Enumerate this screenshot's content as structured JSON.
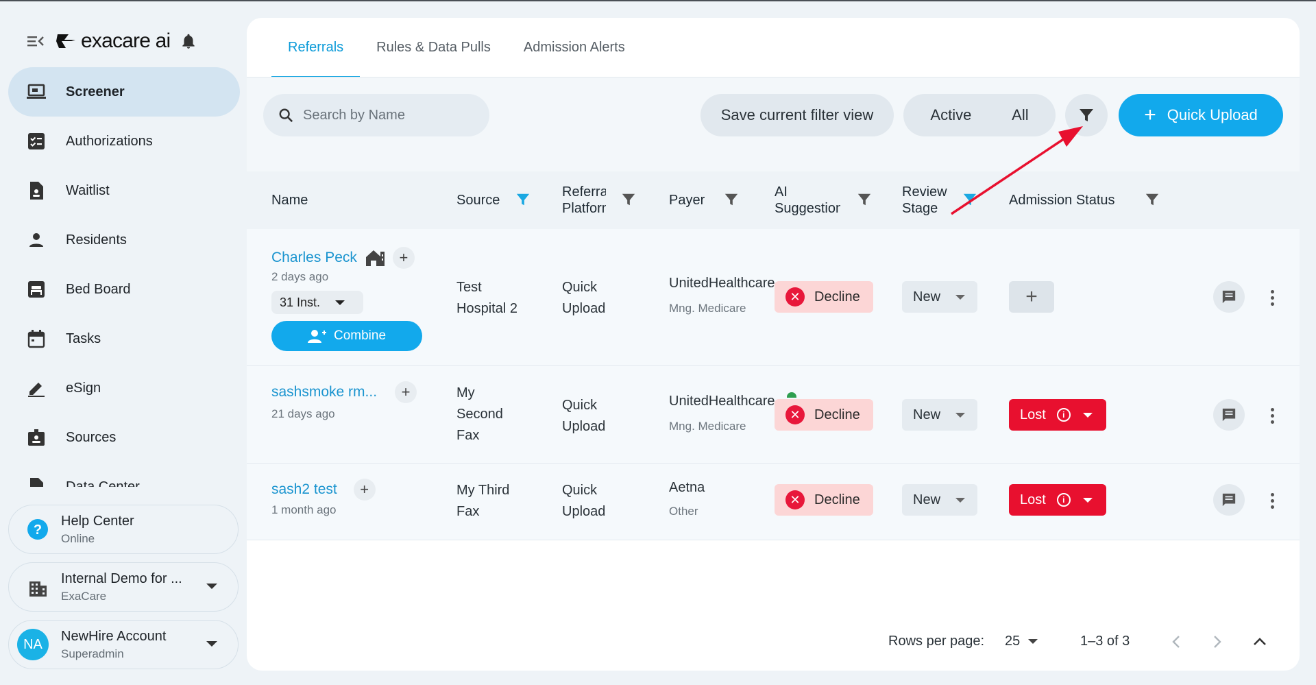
{
  "brand": {
    "name": "exacare ai"
  },
  "sidebar": {
    "items": [
      {
        "label": "Screener",
        "icon": "laptop-icon",
        "active": true
      },
      {
        "label": "Authorizations",
        "icon": "checklist-icon"
      },
      {
        "label": "Waitlist",
        "icon": "document-icon"
      },
      {
        "label": "Residents",
        "icon": "person-icon"
      },
      {
        "label": "Bed Board",
        "icon": "bed-icon"
      },
      {
        "label": "Tasks",
        "icon": "calendar-icon"
      },
      {
        "label": "eSign",
        "icon": "pen-icon"
      },
      {
        "label": "Sources",
        "icon": "id-badge-icon"
      },
      {
        "label": "Data Center",
        "icon": "data-icon"
      }
    ],
    "help": {
      "title": "Help Center",
      "status": "Online"
    },
    "org": {
      "title": "Internal Demo for ...",
      "sub": "ExaCare"
    },
    "account": {
      "initials": "NA",
      "title": "NewHire Account",
      "sub": "Superadmin"
    }
  },
  "tabs": [
    "Referrals",
    "Rules & Data Pulls",
    "Admission Alerts"
  ],
  "toolbar": {
    "search_placeholder": "Search by Name",
    "save_filter_label": "Save current filter view",
    "active_label": "Active",
    "all_label": "All",
    "quick_upload_label": "Quick Upload"
  },
  "table": {
    "headers": {
      "name": "Name",
      "source": "Source",
      "referral_platform": "Referral Platform",
      "payer": "Payer",
      "ai_suggestion": "AI Suggestion",
      "review_stage": "Review Stage",
      "admission_status": "Admission Status"
    },
    "rows": [
      {
        "name": "Charles Peck",
        "time": "2 days ago",
        "inst": "31 Inst.",
        "combine_label": "Combine",
        "source": "Test Hospital 2",
        "platform": "Quick Upload",
        "payer": "UnitedHealthcare",
        "payer_sub": "Mng. Medicare",
        "ai": "Decline",
        "stage": "New",
        "admission": ""
      },
      {
        "name": "sashsmoke rm...",
        "time": "21 days ago",
        "source": "My Second Fax",
        "platform": "Quick Upload",
        "payer": "UnitedHealthcare",
        "payer_sub": "Mng. Medicare",
        "ai": "Decline",
        "stage": "New",
        "admission": "Lost"
      },
      {
        "name": "sash2 test",
        "time": "1 month ago",
        "source": "My Third Fax",
        "platform": "Quick Upload",
        "payer": "Aetna",
        "payer_sub": "Other",
        "ai": "Decline",
        "stage": "New",
        "admission": "Lost"
      }
    ]
  },
  "pagination": {
    "rows_per_page_label": "Rows per page:",
    "rows_per_page": "25",
    "range": "1–3 of 3"
  },
  "colors": {
    "accent": "#12a9ec",
    "decline_bg": "#fcd6d6",
    "lost_bg": "#e8102f",
    "active_nav_bg": "#d3e4f1",
    "annotation_arrow": "#e8102f"
  }
}
